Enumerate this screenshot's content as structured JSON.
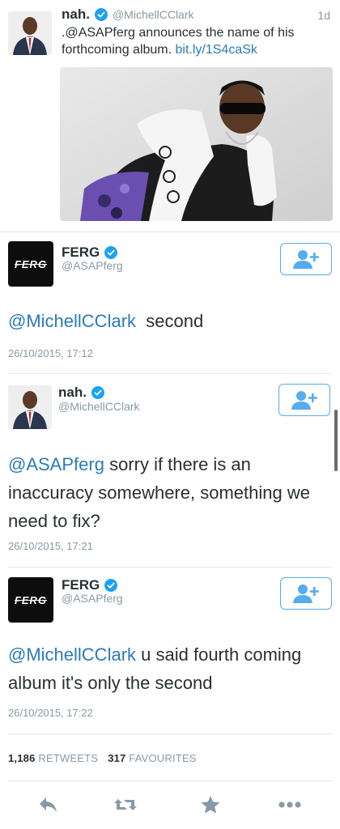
{
  "quoted_tweet": {
    "name": "nah.",
    "handle": "@MichellCClark",
    "time": "1d",
    "text_prefix": ".@ASAPferg announces the name of his forthcoming album.",
    "link": "bit.ly/1S4caSk",
    "image_icon": "photo-of-rapper"
  },
  "replies": [
    {
      "name": "FERG",
      "handle": "@ASAPferg",
      "avatar_text": "FERG",
      "mention": "@MichellCClark",
      "text": "second",
      "timestamp": "26/10/2015, 17:12"
    },
    {
      "name": "nah.",
      "handle": "@MichellCClark",
      "mention": "@ASAPferg",
      "text": "sorry if there is an inaccuracy somewhere, something we need to fix?",
      "timestamp": "26/10/2015, 17:21"
    },
    {
      "name": "FERG",
      "handle": "@ASAPferg",
      "avatar_text": "FERG",
      "mention": "@MichellCClark",
      "text": "u said fourth coming album it's only the second",
      "timestamp": "26/10/2015, 17:22"
    }
  ],
  "stats": {
    "retweets_count": "1,186",
    "retweets_label": "RETWEETS",
    "favourites_count": "317",
    "favourites_label": "FAVOURITES"
  },
  "actions": {
    "reply_icon": "reply-icon",
    "retweet_icon": "retweet-icon",
    "favourite_icon": "star-icon",
    "more_icon": "more-icon"
  },
  "colors": {
    "accent": "#55acee",
    "link": "#2b7bb9",
    "muted": "#8899a6",
    "text": "#292f33",
    "verified": "#1da1f2"
  }
}
